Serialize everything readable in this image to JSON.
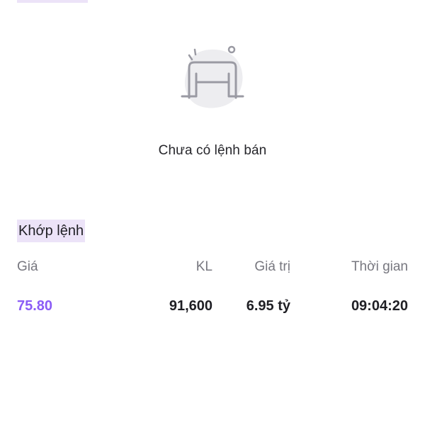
{
  "empty_state": {
    "icon": "empty-inbox-icon",
    "message": "Chưa có lệnh bán"
  },
  "matched_orders": {
    "title": "Khớp lệnh",
    "columns": {
      "price": "Giá",
      "volume": "KL",
      "value": "Giá trị",
      "time": "Thời gian"
    },
    "rows": [
      {
        "price": "75.80",
        "volume": "91,600",
        "value": "6.95 tỷ",
        "time": "09:04:20"
      }
    ]
  },
  "colors": {
    "accent": "#8b5cf6",
    "highlight_bg": "#ece3f8",
    "muted_text": "#77777f"
  }
}
